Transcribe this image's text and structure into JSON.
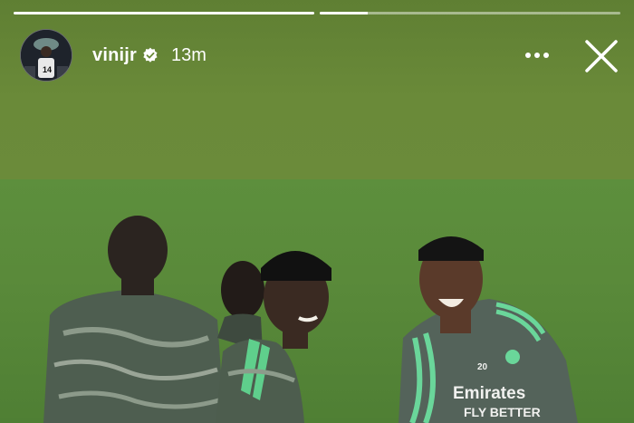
{
  "story": {
    "username": "vinijr",
    "verified": true,
    "time_ago": "13m",
    "progress": {
      "segments": 2,
      "segment_fill": [
        1.0,
        0.16
      ]
    },
    "colors": {
      "overlay_text": "#ffffff",
      "background_top": "#6a8a39",
      "grass": "#5a8a3a"
    },
    "icons": {
      "more": "more-horizontal-icon",
      "close": "close-icon",
      "verified": "verified-badge-icon"
    }
  },
  "photo": {
    "shirt_sponsor_line1": "Emirates",
    "shirt_sponsor_line2": "FLY BETTER",
    "shirt_number": "20"
  }
}
